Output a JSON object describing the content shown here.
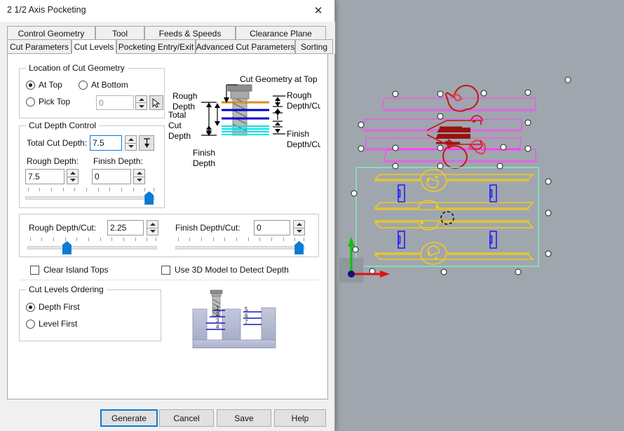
{
  "window": {
    "title": "2 1/2 Axis Pocketing",
    "close_icon": "close-icon"
  },
  "tabs": {
    "row1": [
      {
        "label": "Control Geometry",
        "active": false
      },
      {
        "label": "Tool",
        "active": false
      },
      {
        "label": "Feeds & Speeds",
        "active": false
      },
      {
        "label": "Clearance Plane",
        "active": false
      }
    ],
    "row2": [
      {
        "label": "Cut Parameters",
        "active": false
      },
      {
        "label": "Cut Levels",
        "active": true
      },
      {
        "label": "Pocketing Entry/Exit",
        "active": false
      },
      {
        "label": "Advanced Cut Parameters",
        "active": false
      },
      {
        "label": "Sorting",
        "active": false
      }
    ]
  },
  "location_group": {
    "title": "Location of Cut Geometry",
    "options": [
      {
        "label": "At Top",
        "checked": true
      },
      {
        "label": "At Bottom",
        "checked": false
      },
      {
        "label": "Pick Top",
        "checked": false
      }
    ],
    "pick_top_value": "0",
    "pick_button_icon": "pick-cursor-icon"
  },
  "cut_depth_group": {
    "title": "Cut Depth Control",
    "total_cut_depth": {
      "label": "Total Cut Depth:",
      "value": "7.5"
    },
    "measure_button_icon": "measure-depth-icon",
    "rough_depth": {
      "label": "Rough Depth:",
      "value": "7.5"
    },
    "finish_depth": {
      "label": "Finish Depth:",
      "value": "0"
    },
    "depth_slider_percent": 100
  },
  "per_cut_group": {
    "rough_depth_cut": {
      "label": "Rough Depth/Cut:",
      "value": "2.25"
    },
    "finish_depth_cut": {
      "label": "Finish Depth/Cut:",
      "value": "0"
    },
    "rough_slider_percent": 30,
    "finish_slider_percent": 100
  },
  "checkboxes": [
    {
      "label": "Clear Island Tops",
      "checked": false
    },
    {
      "label": "Use 3D Model to Detect Depth",
      "checked": false
    }
  ],
  "ordering_group": {
    "title": "Cut Levels Ordering",
    "options": [
      {
        "label": "Depth First",
        "checked": true
      },
      {
        "label": "Level First",
        "checked": false
      }
    ],
    "diagram_left_numbers": [
      "1",
      "2",
      "3",
      "4"
    ],
    "diagram_right_numbers": [
      "5",
      "6",
      "7"
    ]
  },
  "depth_diagram": {
    "labels": {
      "rough_depth": "Rough\nDepth",
      "total_cut_depth": "Total\nCut\nDepth",
      "finish_depth": "Finish\nDepth",
      "cut_geometry_at_top": "Cut Geometry at Top",
      "rough_depth_cut": "Rough\nDepth/Cut",
      "finish_depth_cut": "Finish\nDepth/Cut"
    },
    "colors": {
      "top_line": "#e08a1e",
      "rough_line": "#0000cd",
      "finish_line": "#00e5e5"
    }
  },
  "buttons": [
    {
      "label": "Generate",
      "default": true
    },
    {
      "label": "Cancel",
      "default": false
    },
    {
      "label": "Save",
      "default": false
    },
    {
      "label": "Help",
      "default": false
    }
  ],
  "viewport": {
    "background_color": "#a0a6ad",
    "toolpath_rough_color": "#ff40ff",
    "toolpath_finish_color": "#ffd400",
    "stock_box_color": "#7ff0c0",
    "island_color": "#1010ff",
    "marker_color": "#ffffff",
    "entry_marker_color": "#c41414",
    "axis_x_color": "#e01010",
    "axis_y_color": "#10c010",
    "origin_color": "#101080"
  }
}
